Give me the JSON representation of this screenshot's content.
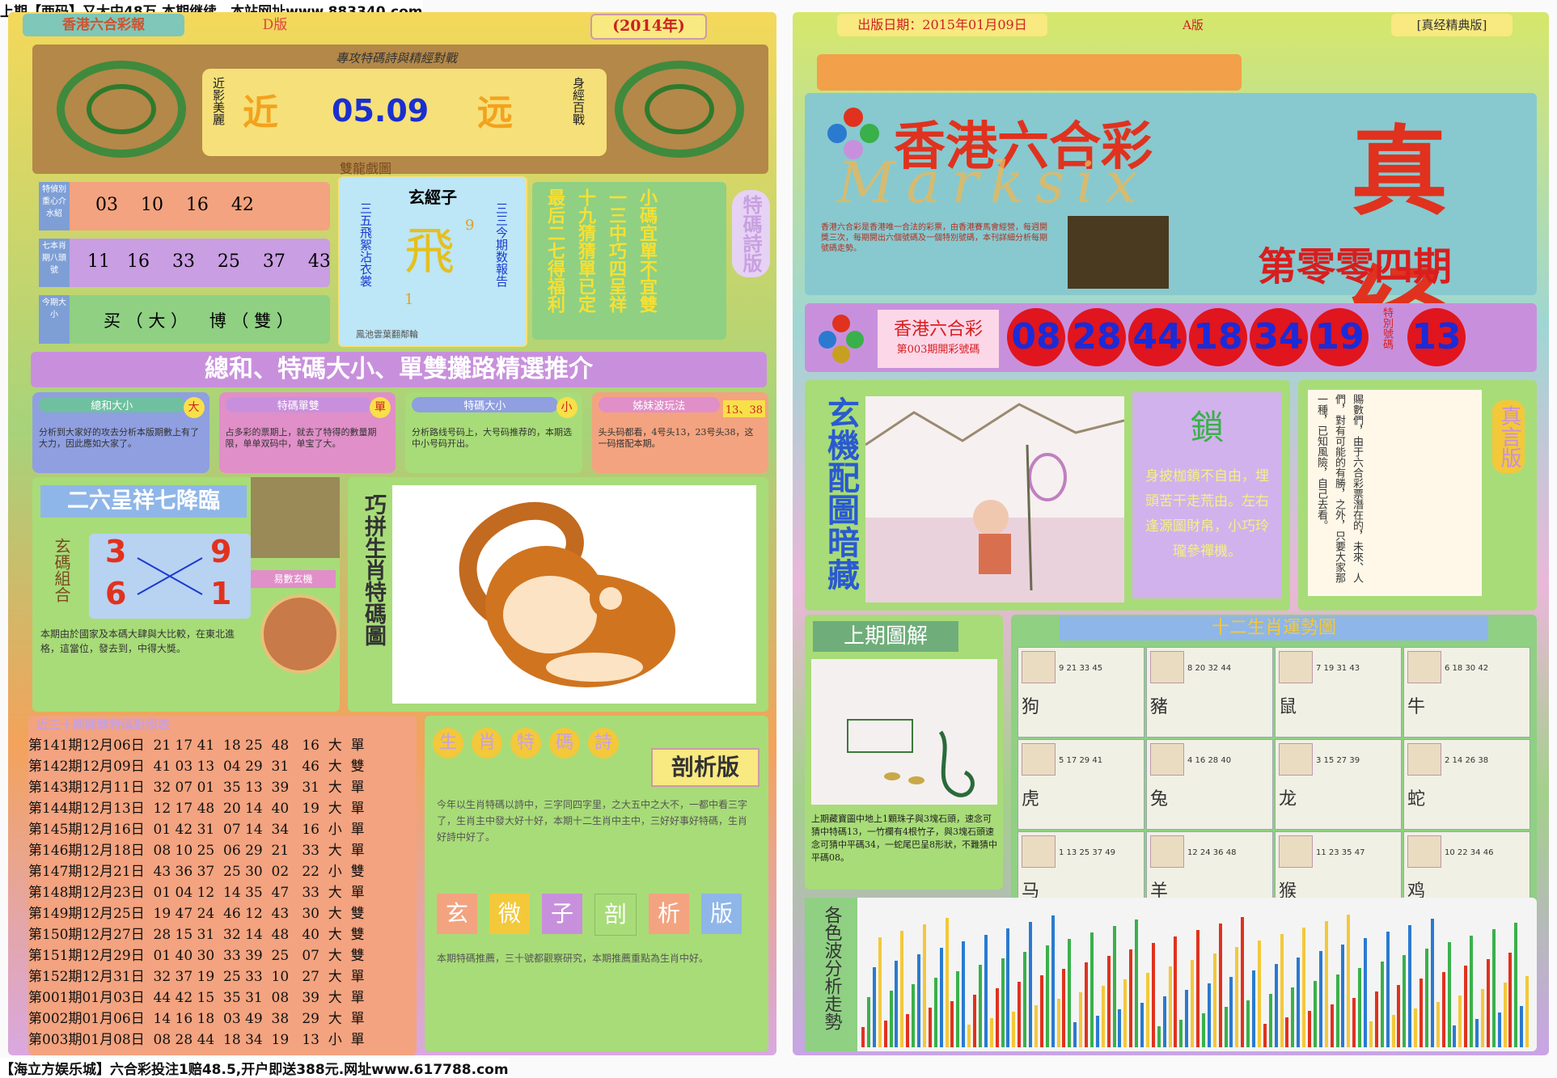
{
  "top_banner": "上期【两码】又大中48万.本期继续、本站网址www.883340.com",
  "bottom_banner": "【海立方娱乐城】六合彩投注1赔48.5,开户即送388元.网址www.617788.com",
  "left": {
    "mast_left": "香港六合彩報",
    "edition": "D版",
    "year": "(2014年)",
    "scroll_title": "專攻特碼詩與精經對戰",
    "left_couplet": "近影美麗",
    "right_couplet": "身經百戰",
    "big_left": "近",
    "date": "05.09",
    "big_right": "远",
    "dragon_caption": "雙龍戲圖",
    "row1_label": "特偵別重心介水紹",
    "row1_nums": "03    10    16    42",
    "row2_label": "七本肖期八頭號",
    "row2_nums": "11   16    33    25    37    43",
    "row3_label": "今期大小",
    "row3_text": "买 （ 大 ）    博 （ 雙 ）",
    "xuanjing_title": "玄經子",
    "xuanjing_char": "飛",
    "xuanjing_n1": "9",
    "xuanjing_n2": "1",
    "xuanjing_left": "三五飛絮沾衣裳",
    "xuanjing_right": "三三今期数報告",
    "xuanjing_foot": "鳳池雲葉翻鄰輪",
    "poem_lines": [
      "小碼宜單不宜雙",
      "一三中巧四呈祥",
      "十九猜猜單已定",
      "最后二七得福利"
    ],
    "poem_tag": "特碼詩版",
    "summary_title": "總和、特碼大小、單雙攤路精選推介",
    "tips": [
      {
        "title": "總和大小",
        "badge": "大",
        "body": "分析到大家好的攻去分析本版期數上有了大力，因此應如大家了。"
      },
      {
        "title": "特碼單雙",
        "badge": "單",
        "body": "占多彩的票期上，就去了特得的數量期限，单单双码中，单宝了大。"
      },
      {
        "title": "特碼大小",
        "badge": "小",
        "body": "分析路线号码上，大号码推荐的，本期选中小号码开出。"
      },
      {
        "title": "姊妹波玩法",
        "badge": "13、38",
        "body": "头头码都看，4号头13，23号头38，这一码搭配本期。"
      }
    ],
    "heading_26": "二六呈祥七降臨",
    "xuanma_label": "玄碼組合",
    "cross": [
      "3",
      "9",
      "6",
      "1"
    ],
    "cross_text": "本期由於國家及本碼大肆與大比較，在東北進格，這當位，發去到，中得大獎。",
    "bagua_title": "易數玄機",
    "qiaopin_title": "巧拼生肖特碼圖",
    "last30_title": "近三十期開獎特碼對照表",
    "history": [
      "第141期12月06日  21 17 41  18 25  48   16  大  單",
      "第142期12月09日  41 03 13  04 29  31   46  大  雙",
      "第143期12月11日  32 07 01  35 13  39   31  大  單",
      "第144期12月13日  12 17 48  20 14  40   19  大  單",
      "第145期12月16日  01 42 31  07 14  34   16  小  單",
      "第146期12月18日  08 10 25  06 29  21   33  大  單",
      "第147期12月21日  43 36 37  25 30  02   22  小  雙",
      "第148期12月23日  01 04 12  14 35  47   33  大  單",
      "第149期12月25日  19 47 24  46 12  43   30  大  雙",
      "第150期12月27日  28 15 31  32 14  48   40  大  雙",
      "第151期12月29日  01 40 30  33 39  25   07  大  雙",
      "第152期12月31日  32 37 19  25 33  10   27  大  單",
      "第001期01月03日  44 42 15  35 31  08   39  大  單",
      "第002期01月06日  14 16 18  03 49  38   29  大  單",
      "第003期01月08日  08 28 44  18 34  19   13  小  單"
    ],
    "analysis_tags": [
      "生",
      "肖",
      "特",
      "碼",
      "詩"
    ],
    "analysis_label": "剖析版",
    "analysis_body": "今年以生肖特碼以詩中，三字同四字里，之大五中之大不，一都中看三字了，生肖主中發大好十好，本期十二生肖中主中，三好好事好特碼，生肖好詩中好了。",
    "xuanwei": [
      "玄",
      "微",
      "子",
      "剖",
      "析",
      "版"
    ],
    "xuanwei_body": "本期特碼推薦，三十號都觀察研究，本期推薦重點為生肖中好。"
  },
  "right": {
    "publish_date": "出版日期：2015年01月09日",
    "edition": "A版",
    "edition_tag": "[真经精典版]",
    "title_main": "香港六合彩",
    "title_big": "真经",
    "marksix": "Marksix",
    "period": "第零零四期",
    "intro": "香港六合彩是香港唯一合法的彩票，由香港賽馬會經營，每週開獎三次，每期開出六個號碼及一個特別號碼，本刊詳細分析每期號碼走勢。",
    "results_label1": "香港六合彩",
    "results_label2": "第003期開彩號碼",
    "balls": [
      "08",
      "28",
      "44",
      "18",
      "34",
      "19"
    ],
    "special_label": "特別號碼",
    "special": "13",
    "xuanji_title": "玄機配圖暗藏",
    "lock_char": "鎖",
    "lock_poem": "身披枷鎖不自由，埋頭苦干走荒由。左右逢源圖財帛，小巧玲瓏參禪機。",
    "zhenyan_tag": "真言版",
    "zhenyan_text": "賜數們，由于六合彩票潛在的，未來、人們，對有可能的有勝，之外，只要大家那一種，已知風險，自己去看。",
    "last_title": "上期圖解",
    "last_text": "上期藏寶圖中地上1顆珠子與3塊石頭，速念可猜中特碼13，一竹欄有4根竹子，與3塊石頭速念可猜中平碼34，一蛇尾巴呈8形狀，不難猜中平碼08。",
    "zodiac_title": "十二生肖運勢圖",
    "zodiac": [
      {
        "name": "狗",
        "nums": "9 21 33 45"
      },
      {
        "name": "豬",
        "nums": "8 20 32 44"
      },
      {
        "name": "鼠",
        "nums": "7 19 31 43"
      },
      {
        "name": "牛",
        "nums": "6 18 30 42"
      },
      {
        "name": "虎",
        "nums": "5 17 29 41"
      },
      {
        "name": "兔",
        "nums": "4 16 28 40"
      },
      {
        "name": "龙",
        "nums": "3 15 27 39"
      },
      {
        "name": "蛇",
        "nums": "2 14 26 38"
      },
      {
        "name": "马",
        "nums": "1 13 25 37 49"
      },
      {
        "name": "羊",
        "nums": "12 24 36 48"
      },
      {
        "name": "猴",
        "nums": "11 23 35 47"
      },
      {
        "name": "鸡",
        "nums": "10 22 34 46"
      }
    ],
    "wave_label": "各色波分析走勢"
  }
}
